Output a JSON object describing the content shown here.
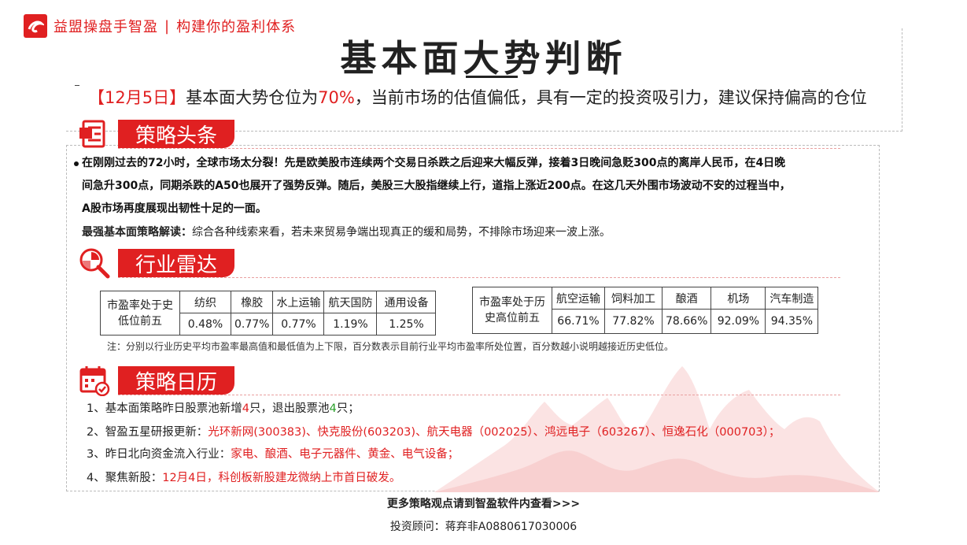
{
  "brand": {
    "name": "益盟操盘手智盈",
    "slogan": "构建你的盈利体系",
    "separator": "|"
  },
  "title": "基本面大势判断",
  "summary": {
    "date": "【12月5日】",
    "text1": "基本面大势仓位为",
    "percent": "70%",
    "text2": "，当前市场的估值偏低，具有一定的投资吸引力，建议保持偏高的仓位"
  },
  "sections": {
    "strategy_headline": "策略头条",
    "industry_radar": "行业雷达",
    "strategy_calendar": "策略日历"
  },
  "headline": {
    "paragraph": "在刚刚过去的72小时，全球市场太分裂！先是欧美股市连续两个交易日杀跌之后迎来大幅反弹，接着3日晚间急贬300点的离岸人民币，在4日晚间急升300点，同期杀跌的A50也展开了强势反弹。随后，美股三大股指继续上行，道指上涨近200点。在这几天外围市场波动不安的过程当中，A股市场再度展现出韧性十足的一面。",
    "line1": "在刚刚过去的72小时，全球市场太分裂！先是欧美股市连续两个交易日杀跌之后迎来大幅反弹，接着3日晚间急贬300点的离岸人民币，在4日晚",
    "line2": "间急升300点，同期杀跌的A50也展开了强势反弹。随后，美股三大股指继续上行，道指上涨近200点。在这几天外围市场波动不安的过程当中，",
    "line3": "A股市场再度展现出韧性十足的一面。",
    "interpret_label": "最强基本面策略解读：",
    "interpret_text": "综合各种线索来看，若未来贸易争端出现真正的缓和局势，不排除市场迎来一波上涨。"
  },
  "radar": {
    "low_table": {
      "label": "市盈率处于史低位前五",
      "label_line1": "市盈率处于史",
      "label_line2": "低位前五",
      "industries": [
        "纺织",
        "橡胶",
        "水上运输",
        "航天国防",
        "通用设备"
      ],
      "values": [
        "0.48%",
        "0.77%",
        "0.77%",
        "1.19%",
        "1.25%"
      ]
    },
    "high_table": {
      "label": "市盈率处于历史高位前五",
      "label_line1": "市盈率处于历",
      "label_line2": "史高位前五",
      "industries": [
        "航空运输",
        "饲料加工",
        "酿酒",
        "机场",
        "汽车制造"
      ],
      "values": [
        "66.71%",
        "77.82%",
        "78.66%",
        "92.09%",
        "94.35%"
      ]
    },
    "note": "注：分别以行业历史平均市盈率最高值和最低值为上下限，百分数表示目前行业平均市盈率所处位置，百分数越小说明越接近历史低位。"
  },
  "calendar": {
    "item1": {
      "prefix": "1、基本面策略昨日股票池新增",
      "add_count": "4",
      "mid": "只，退出股票池",
      "exit_count": "4",
      "suffix": "只；"
    },
    "item2": {
      "prefix": "2、智盈五星研报更新：",
      "text": "光环新网(300383)、快克股份(603203)、航天电器（002025）、鸿远电子（603267）、恒逸石化（000703）；"
    },
    "item3": {
      "prefix": "3、昨日北向资金流入行业：",
      "text": "家电、酿酒、电子元器件、黄金、电气设备；"
    },
    "item4": {
      "prefix": "4、聚焦新股：",
      "text": "12月4日，科创板新股建龙微纳上市首日破发。"
    }
  },
  "footer": {
    "more": "更多策略观点请到智盈软件内查看>>>",
    "advisor": "投资顾问：蒋弃非A0880617030006"
  },
  "colors": {
    "accent": "#e02021",
    "green": "#2aa02a",
    "text": "#222222"
  }
}
